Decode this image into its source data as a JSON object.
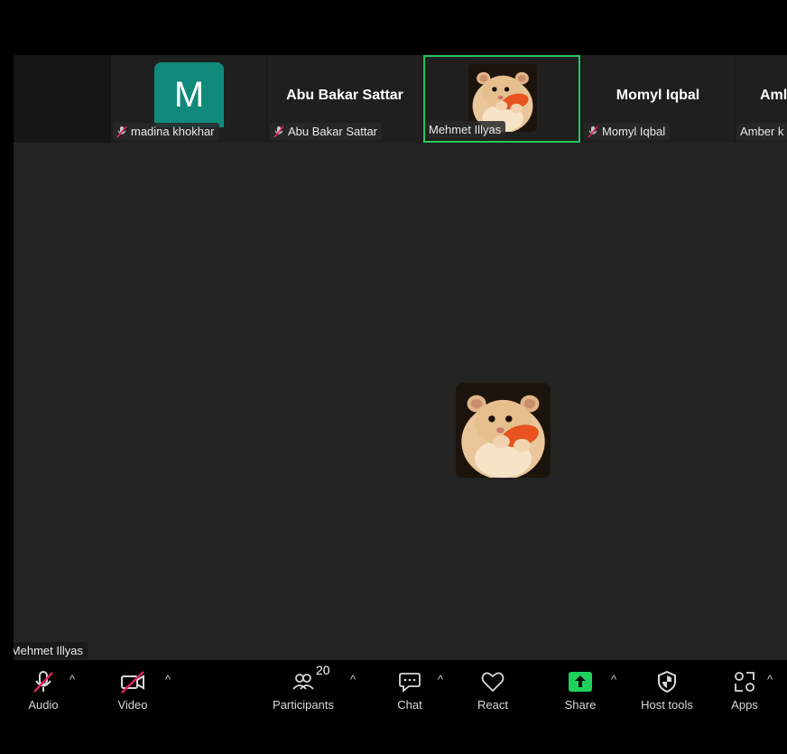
{
  "participants_strip": [
    {
      "name": "madina khokhar",
      "avatar_letter": "M",
      "avatar_color": "#0f8a7a",
      "muted": true
    },
    {
      "name": "Abu Bakar Sattar",
      "display_name": "Abu Bakar Sattar",
      "muted": true
    },
    {
      "name": "Mehmet Illyas",
      "has_photo": true,
      "active_speaker": true,
      "muted": false
    },
    {
      "name": "Momyl Iqbal",
      "display_name": "Momyl Iqbal",
      "muted": true
    },
    {
      "name": "Amber k",
      "display_name": "Aml",
      "muted": false
    }
  ],
  "main_view": {
    "speaker_label": "Mehmet Illyas",
    "speaker_label_truncated": "hmet Illyas"
  },
  "toolbar": {
    "audio_label": "Audio",
    "video_label": "Video",
    "participants_label": "Participants",
    "participants_count": "20",
    "chat_label": "Chat",
    "react_label": "React",
    "share_label": "Share",
    "host_tools_label": "Host tools",
    "apps_label": "Apps",
    "caret": "^"
  },
  "colors": {
    "active_border": "#22c55e",
    "share_green": "#1fd15b",
    "mute_red": "#e0245e",
    "stage_bg": "#232323"
  }
}
